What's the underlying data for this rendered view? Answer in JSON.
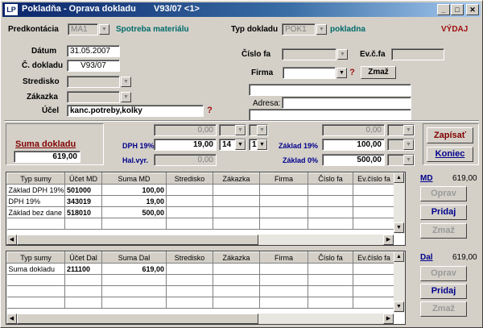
{
  "title": {
    "logo": "LP",
    "text": "Pokladňa - Oprava dokladu",
    "code": "V93/07   <1>",
    "min": "_",
    "max": "□",
    "close": "✕"
  },
  "top": {
    "predkontacia_label": "Predkontácia",
    "predkontacia_value": "MA1",
    "predkontacia_desc": "Spotreba materiálu",
    "typ_label": "Typ dokladu",
    "typ_value": "POK1",
    "typ_desc": "pokladna",
    "vydaj": "VÝDAJ"
  },
  "left": {
    "datum_label": "Dátum",
    "datum_value": "31.05.2007",
    "cislo_label": "Č. dokladu",
    "cislo_value": "V93/07",
    "stredisko_label": "Stredisko",
    "zakazka_label": "Zákazka",
    "ucel_label": "Účel",
    "ucel_value": "kanc.potreby,kolky"
  },
  "right": {
    "cislofa_label": "Číslo fa",
    "evcfa_label": "Ev.č.fa",
    "firma_label": "Firma",
    "zmaz": "Zmaž",
    "adresa_label": "Adresa:"
  },
  "amounts": {
    "suma_label": "Suma dokladu",
    "suma_value": "619,00",
    "r1_val": "0,00",
    "dph19_label": "DPH 19%",
    "dph19_value": "19,00",
    "dph_sel1": "14",
    "dph_sel2": "1",
    "halvyr_label": "Hal.vyr.",
    "halvyr_value": "0,00",
    "r1_right": "0,00",
    "zaklad19_label": "Základ 19%",
    "zaklad19_value": "100,00",
    "zaklad0_label": "Základ 0%",
    "zaklad0_value": "500,00",
    "zapisat": "Zapísať",
    "koniec": "Koniec"
  },
  "md_grid": {
    "headers": [
      "Typ sumy",
      "Účet MD",
      "Suma MD",
      "Stredisko",
      "Zákazka",
      "Firma",
      "Číslo fa",
      "Ev.číslo fa"
    ],
    "rows": [
      [
        "Základ DPH 19%",
        "501000",
        "100,00"
      ],
      [
        "DPH 19%",
        "343019",
        "19,00"
      ],
      [
        "Základ bez dane",
        "518010",
        "500,00"
      ]
    ],
    "side_label": "MD",
    "side_value": "619,00",
    "oprav": "Oprav",
    "pridaj": "Pridaj",
    "zmaz": "Zmaž"
  },
  "dal_grid": {
    "headers": [
      "Typ sumy",
      "Účet Dal",
      "Suma Dal",
      "Stredisko",
      "Zákazka",
      "Firma",
      "Číslo fa",
      "Ev.číslo fa"
    ],
    "rows": [
      [
        "Suma dokladu",
        "211100",
        "619,00"
      ]
    ],
    "side_label": "Dal",
    "side_value": "619,00",
    "oprav": "Oprav",
    "pridaj": "Pridaj",
    "zmaz": "Zmaž"
  }
}
